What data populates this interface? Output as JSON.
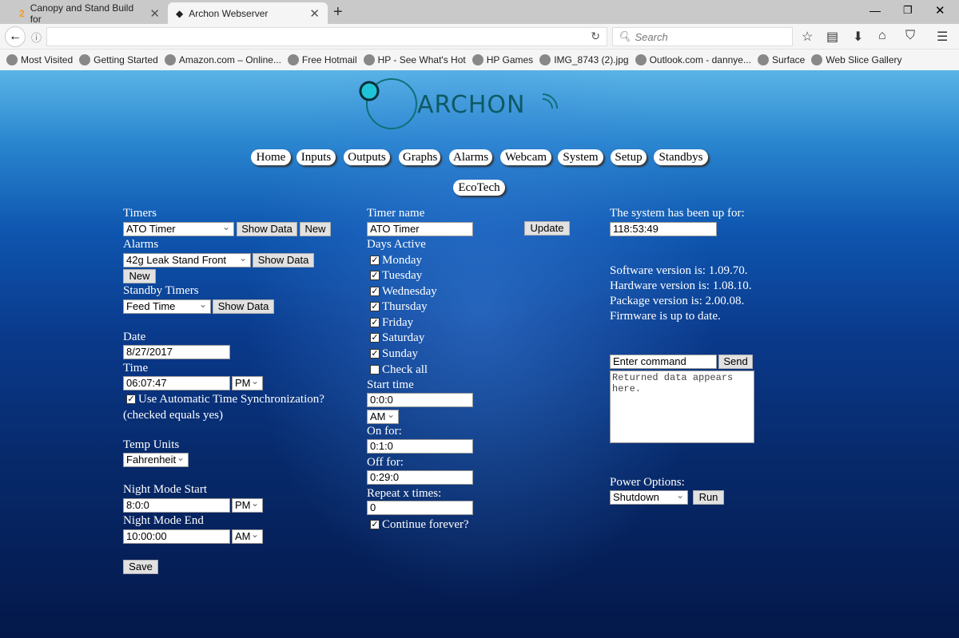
{
  "browser": {
    "tabs": [
      {
        "title": "Canopy and Stand Build for",
        "icon": "forum-icon",
        "active": false
      },
      {
        "title": "Archon Webserver",
        "icon": "archon-icon",
        "active": true
      }
    ],
    "search_placeholder": "Search",
    "bookmarks": [
      "Most Visited",
      "Getting Started",
      "Amazon.com – Online...",
      "Free Hotmail",
      "HP - See What's Hot",
      "HP Games",
      "IMG_8743 (2).jpg",
      "Outlook.com - dannye...",
      "Surface",
      "Web Slice Gallery"
    ]
  },
  "logo": {
    "text": "ARCHON"
  },
  "nav": [
    "Home",
    "Inputs",
    "Outputs",
    "Graphs",
    "Alarms",
    "Webcam",
    "System",
    "Setup",
    "Standbys",
    "EcoTech"
  ],
  "left": {
    "timers_label": "Timers",
    "timers_value": "ATO Timer",
    "show_data": "Show Data",
    "new": "New",
    "alarms_label": "Alarms",
    "alarms_value": "42g Leak Stand Front",
    "standby_label": "Standby Timers",
    "standby_value": "Feed Time",
    "date_label": "Date",
    "date_value": "8/27/2017",
    "time_label": "Time",
    "time_value": "06:07:47",
    "time_ampm": "PM",
    "auto_sync_label": "Use Automatic Time Synchronization?",
    "auto_sync_checked": true,
    "auto_sync_note": "(checked equals yes)",
    "temp_label": "Temp Units",
    "temp_value": "Fahrenheit",
    "night_start_label": "Night Mode Start",
    "night_start_value": "8:0:0",
    "night_start_ampm": "PM",
    "night_end_label": "Night Mode End",
    "night_end_value": "10:00:00",
    "night_end_ampm": "AM",
    "save": "Save"
  },
  "middle": {
    "timer_name_label": "Timer name",
    "timer_name_value": "ATO Timer",
    "update": "Update",
    "days_label": "Days Active",
    "days": [
      {
        "label": "Monday",
        "checked": true
      },
      {
        "label": "Tuesday",
        "checked": true
      },
      {
        "label": "Wednesday",
        "checked": true
      },
      {
        "label": "Thursday",
        "checked": true
      },
      {
        "label": "Friday",
        "checked": true
      },
      {
        "label": "Saturday",
        "checked": true
      },
      {
        "label": "Sunday",
        "checked": true
      },
      {
        "label": "Check all",
        "checked": false
      }
    ],
    "start_label": "Start time",
    "start_value": "0:0:0",
    "start_ampm": "AM",
    "on_label": "On for:",
    "on_value": "0:1:0",
    "off_label": "Off for:",
    "off_value": "0:29:0",
    "repeat_label": "Repeat x times:",
    "repeat_value": "0",
    "forever_label": "Continue forever?",
    "forever_checked": true
  },
  "right": {
    "uptime_label": "The system has been up for:",
    "uptime_value": "118:53:49",
    "versions": [
      "Software version is: 1.09.70.",
      "Hardware version is: 1.08.10.",
      "Package version is: 2.00.08.",
      "Firmware is up to date."
    ],
    "command_value": "Enter command",
    "send": "Send",
    "returned": "Returned data appears here.",
    "power_label": "Power Options:",
    "power_value": "Shutdown",
    "run": "Run"
  }
}
